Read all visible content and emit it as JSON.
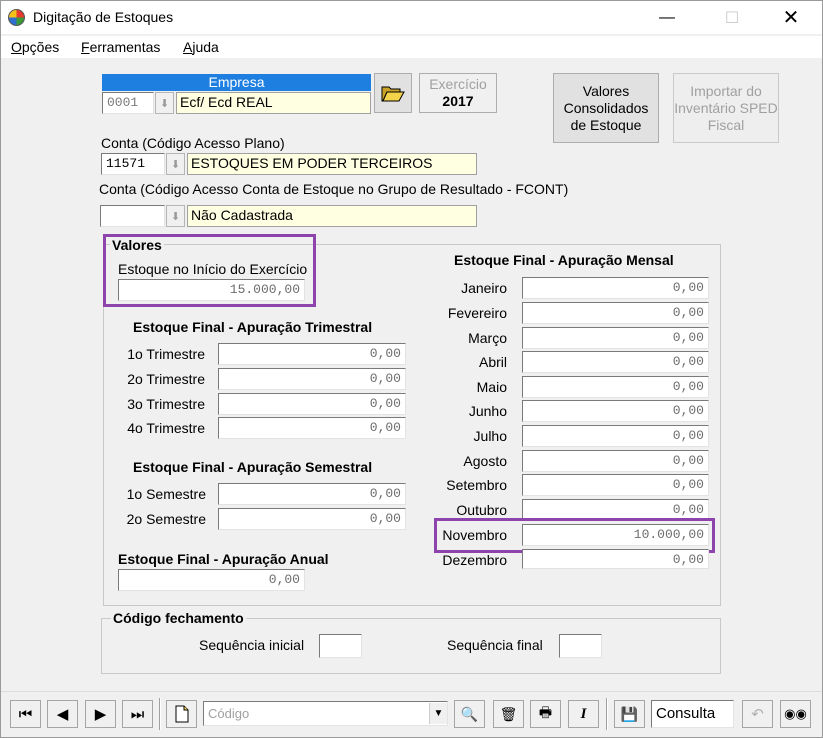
{
  "window": {
    "title": "Digitação de Estoques"
  },
  "menu": [
    {
      "accel": "O",
      "rest": "pções"
    },
    {
      "accel": "F",
      "rest": "erramentas"
    },
    {
      "accel": "A",
      "rest": "juda"
    }
  ],
  "empresa": {
    "header": "Empresa",
    "code": "0001",
    "name": "Ecf/ Ecd REAL"
  },
  "exercicio": {
    "label": "Exercício",
    "year": "2017"
  },
  "buttons": {
    "valores_consolidados": "Valores Consolidados de Estoque",
    "importar_inventario": "Importar do Inventário SPED Fiscal"
  },
  "conta": {
    "label": "Conta (Código Acesso Plano)",
    "code": "11571",
    "name": "ESTOQUES EM PODER TERCEIROS"
  },
  "conta_fcont": {
    "label": "Conta (Código Acesso Conta de Estoque no Grupo de Resultado - FCONT)",
    "code": "",
    "name": "Não Cadastrada"
  },
  "valores": {
    "title": "Valores",
    "inicio_label": "Estoque no Início do Exercício",
    "inicio_value": "15.000,00"
  },
  "trimestral": {
    "title": "Estoque Final - Apuração Trimestral",
    "rows": [
      {
        "label": "1o Trimestre",
        "value": "0,00"
      },
      {
        "label": "2o Trimestre",
        "value": "0,00"
      },
      {
        "label": "3o Trimestre",
        "value": "0,00"
      },
      {
        "label": "4o Trimestre",
        "value": "0,00"
      }
    ]
  },
  "semestral": {
    "title": "Estoque Final - Apuração Semestral",
    "rows": [
      {
        "label": "1o Semestre",
        "value": "0,00"
      },
      {
        "label": "2o Semestre",
        "value": "0,00"
      }
    ]
  },
  "anual": {
    "title": "Estoque Final - Apuração Anual",
    "value": "0,00"
  },
  "mensal": {
    "title": "Estoque Final - Apuração Mensal",
    "rows": [
      {
        "label": "Janeiro",
        "value": "0,00"
      },
      {
        "label": "Fevereiro",
        "value": "0,00"
      },
      {
        "label": "Março",
        "value": "0,00"
      },
      {
        "label": "Abril",
        "value": "0,00"
      },
      {
        "label": "Maio",
        "value": "0,00"
      },
      {
        "label": "Junho",
        "value": "0,00"
      },
      {
        "label": "Julho",
        "value": "0,00"
      },
      {
        "label": "Agosto",
        "value": "0,00"
      },
      {
        "label": "Setembro",
        "value": "0,00"
      },
      {
        "label": "Outubro",
        "value": "0,00"
      },
      {
        "label": "Novembro",
        "value": "10.000,00"
      },
      {
        "label": "Dezembro",
        "value": "0,00"
      }
    ]
  },
  "fechamento": {
    "title": "Código fechamento",
    "seq_inicial_label": "Sequência inicial",
    "seq_inicial_value": "",
    "seq_final_label": "Sequência final",
    "seq_final_value": ""
  },
  "toolbar": {
    "codigo_placeholder": "Código",
    "mode": "Consulta"
  },
  "colors": {
    "highlight": "#8e44ad",
    "empresa_header": "#1e7fe0",
    "yellow_field": "#ffffe1"
  }
}
